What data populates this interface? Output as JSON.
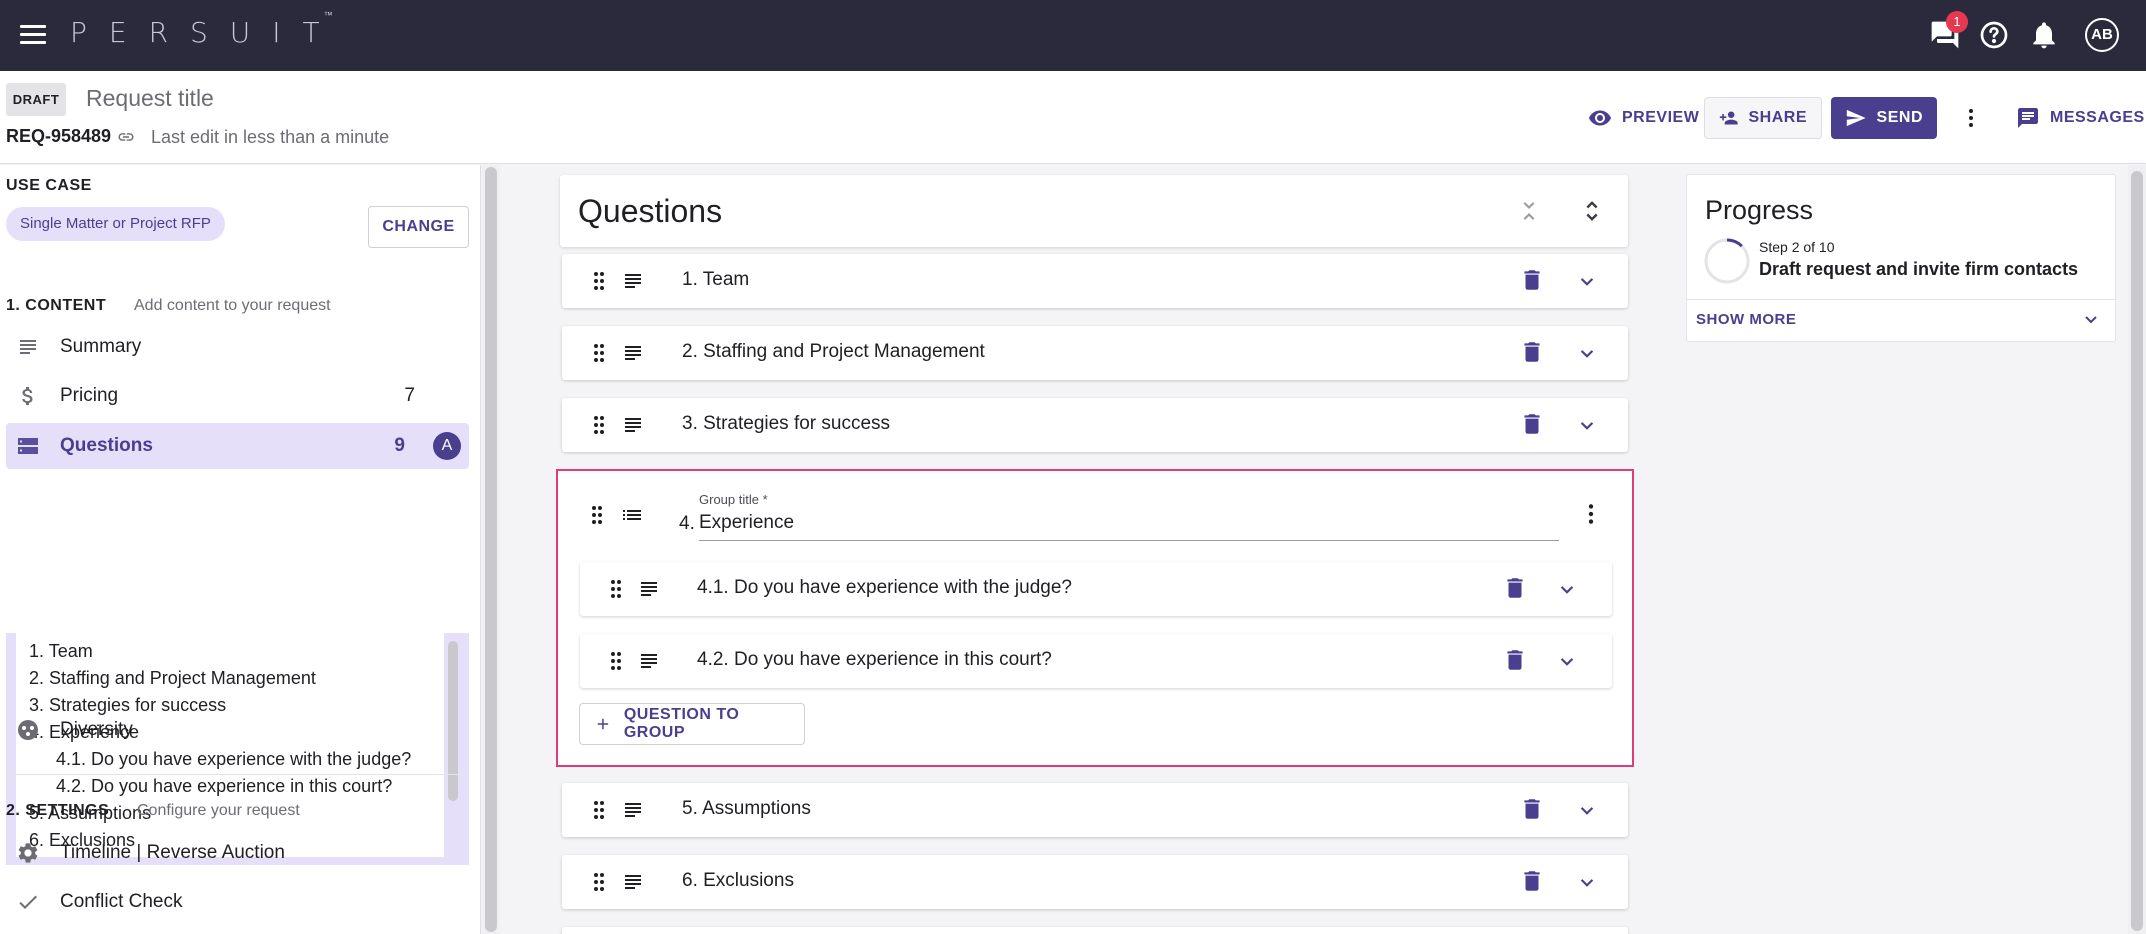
{
  "topbar": {
    "logo": "PERSUIT",
    "logo_tm": "™",
    "notification_count": "1",
    "avatar_initials": "AB"
  },
  "header": {
    "status": "DRAFT",
    "title_placeholder": "Request title",
    "request_id": "REQ-958489",
    "last_edit": "Last edit in less than a minute",
    "preview_label": "PREVIEW",
    "share_label": "SHARE",
    "send_label": "SEND",
    "messages_label": "MESSAGES"
  },
  "sidebar": {
    "use_case_label": "USE CASE",
    "use_case_value": "Single Matter or Project RFP",
    "change_label": "CHANGE",
    "content_section": "1. CONTENT",
    "content_sub": "Add content to your request",
    "items": [
      {
        "label": "Summary",
        "count": "",
        "icon": "subject-icon"
      },
      {
        "label": "Pricing",
        "count": "7",
        "icon": "dollar-icon"
      },
      {
        "label": "Questions",
        "count": "9",
        "icon": "questions-icon",
        "badge": "A"
      },
      {
        "label": "Diversity",
        "count": "",
        "icon": "diversity-icon"
      }
    ],
    "questions_tree": [
      "1. Team",
      "2. Staffing and Project Management",
      "3. Strategies for success",
      "4. Experience",
      "4.1. Do you have experience with the judge?",
      "4.2. Do you have experience in this court?",
      "5. Assumptions",
      "6. Exclusions"
    ],
    "settings_section": "2. SETTINGS",
    "settings_sub": "Configure your request",
    "settings_items": [
      {
        "label": "Timeline | Reverse Auction",
        "icon": "gear-icon"
      },
      {
        "label": "Conflict Check",
        "icon": "check-icon"
      }
    ]
  },
  "main": {
    "title": "Questions",
    "questions": [
      {
        "label": "1. Team"
      },
      {
        "label": "2. Staffing and Project Management"
      },
      {
        "label": "3. Strategies for success"
      },
      {
        "label": "5. Assumptions"
      },
      {
        "label": "6. Exclusions"
      }
    ],
    "group": {
      "field_label": "Group title *",
      "number": "4.",
      "value": "Experience",
      "sub_questions": [
        {
          "label": "4.1. Do you have experience with the judge?"
        },
        {
          "label": "4.2. Do you have experience in this court?"
        }
      ],
      "add_label": "QUESTION TO GROUP"
    }
  },
  "progress": {
    "title": "Progress",
    "step": "Step 2 of 10",
    "step_title": "Draft request and invite firm contacts",
    "show_more": "SHOW MORE"
  },
  "colors": {
    "primary": "#4a3f8f",
    "topbar": "#2b2a3d",
    "active_bg": "#e5dffa",
    "highlight_border": "#e03c7a",
    "badge_red": "#e53950"
  }
}
